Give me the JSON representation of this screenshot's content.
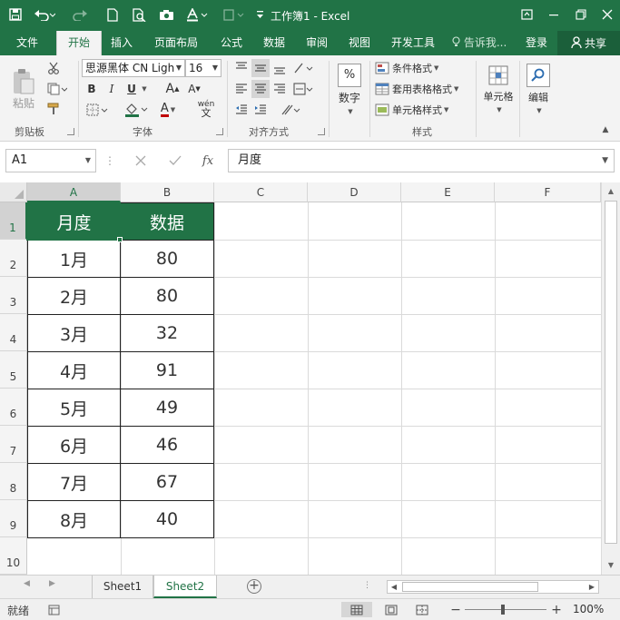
{
  "window": {
    "title": "工作簿1 - Excel"
  },
  "tabs": [
    {
      "label": "文件"
    },
    {
      "label": "开始"
    },
    {
      "label": "插入"
    },
    {
      "label": "页面布局"
    },
    {
      "label": "公式"
    },
    {
      "label": "数据"
    },
    {
      "label": "审阅"
    },
    {
      "label": "视图"
    },
    {
      "label": "开发工具"
    }
  ],
  "tell_me": "告诉我...",
  "signin": "登录",
  "share": "共享",
  "ribbon": {
    "clipboard": {
      "paste": "粘贴",
      "label": "剪贴板"
    },
    "font": {
      "name": "思源黑体 CN Ligh",
      "size": "16",
      "bold": "B",
      "italic": "I",
      "underline": "U",
      "grow": "A",
      "shrink": "A",
      "font_color": "A",
      "phonetic": "wén",
      "label": "字体"
    },
    "alignment": {
      "label": "对齐方式"
    },
    "number": {
      "button": "数字",
      "percent": "%"
    },
    "styles": {
      "conditional": "条件格式",
      "table": "套用表格格式",
      "cell": "单元格样式",
      "label": "样式"
    },
    "cells": {
      "button": "单元格"
    },
    "editing": {
      "button": "编辑"
    }
  },
  "formula_bar": {
    "name_box": "A1",
    "fx": "fx",
    "value": "月度"
  },
  "columns": [
    "A",
    "B",
    "C",
    "D",
    "E",
    "F"
  ],
  "rows": [
    "1",
    "2",
    "3",
    "4",
    "5",
    "6",
    "7",
    "8",
    "9",
    "10"
  ],
  "table": {
    "headers": [
      "月度",
      "数据"
    ],
    "rows": [
      [
        "1月",
        "80"
      ],
      [
        "2月",
        "80"
      ],
      [
        "3月",
        "32"
      ],
      [
        "4月",
        "91"
      ],
      [
        "5月",
        "49"
      ],
      [
        "6月",
        "46"
      ],
      [
        "7月",
        "67"
      ],
      [
        "8月",
        "40"
      ]
    ]
  },
  "sheets": [
    {
      "name": "Sheet1"
    },
    {
      "name": "Sheet2"
    }
  ],
  "status": {
    "text": "就绪",
    "zoom": "100%"
  },
  "colors": {
    "accent": "#217346"
  }
}
